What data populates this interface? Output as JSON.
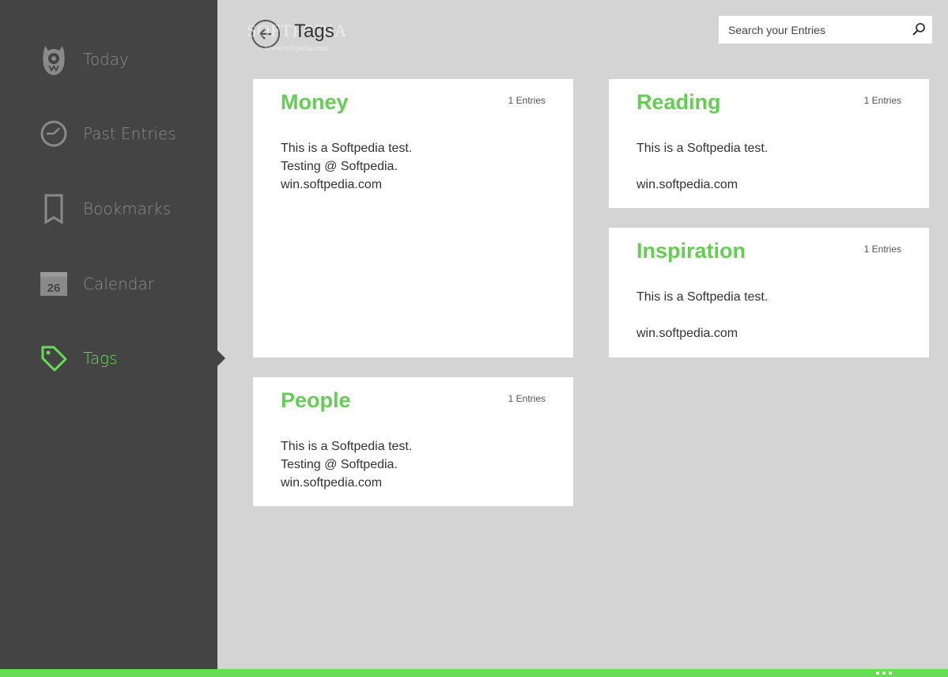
{
  "sidebar": {
    "items": [
      {
        "label": "Today",
        "icon": "owl-icon",
        "active": false
      },
      {
        "label": "Past Entries",
        "icon": "clock-icon",
        "active": false
      },
      {
        "label": "Bookmarks",
        "icon": "bookmark-icon",
        "active": false
      },
      {
        "label": "Calendar",
        "icon": "calendar-icon",
        "calendar_day": "26",
        "active": false
      },
      {
        "label": "Tags",
        "icon": "tag-icon",
        "active": true
      }
    ]
  },
  "header": {
    "title": "Tags",
    "watermark": "SOFTPEDIA",
    "watermark_url": "www.softpedia.com",
    "search_placeholder": "Search your Entries"
  },
  "cards": [
    {
      "title": "Money",
      "count": "1 Entries",
      "lines": [
        "This is a Softpedia test.",
        "Testing @ Softpedia.",
        "win.softpedia.com"
      ]
    },
    {
      "title": "Reading",
      "count": "1 Entries",
      "lines": [
        "This is a Softpedia test.",
        "",
        "win.softpedia.com"
      ]
    },
    {
      "title": "Inspiration",
      "count": "1 Entries",
      "lines": [
        "This is a Softpedia test.",
        "",
        "win.softpedia.com"
      ]
    },
    {
      "title": "People",
      "count": "1 Entries",
      "lines": [
        "This is a Softpedia test.",
        "Testing @ Softpedia.",
        "win.softpedia.com"
      ]
    }
  ],
  "colors": {
    "accent": "#66dd55",
    "sidebar_bg": "#444444",
    "content_bg": "#d4d4d4"
  }
}
